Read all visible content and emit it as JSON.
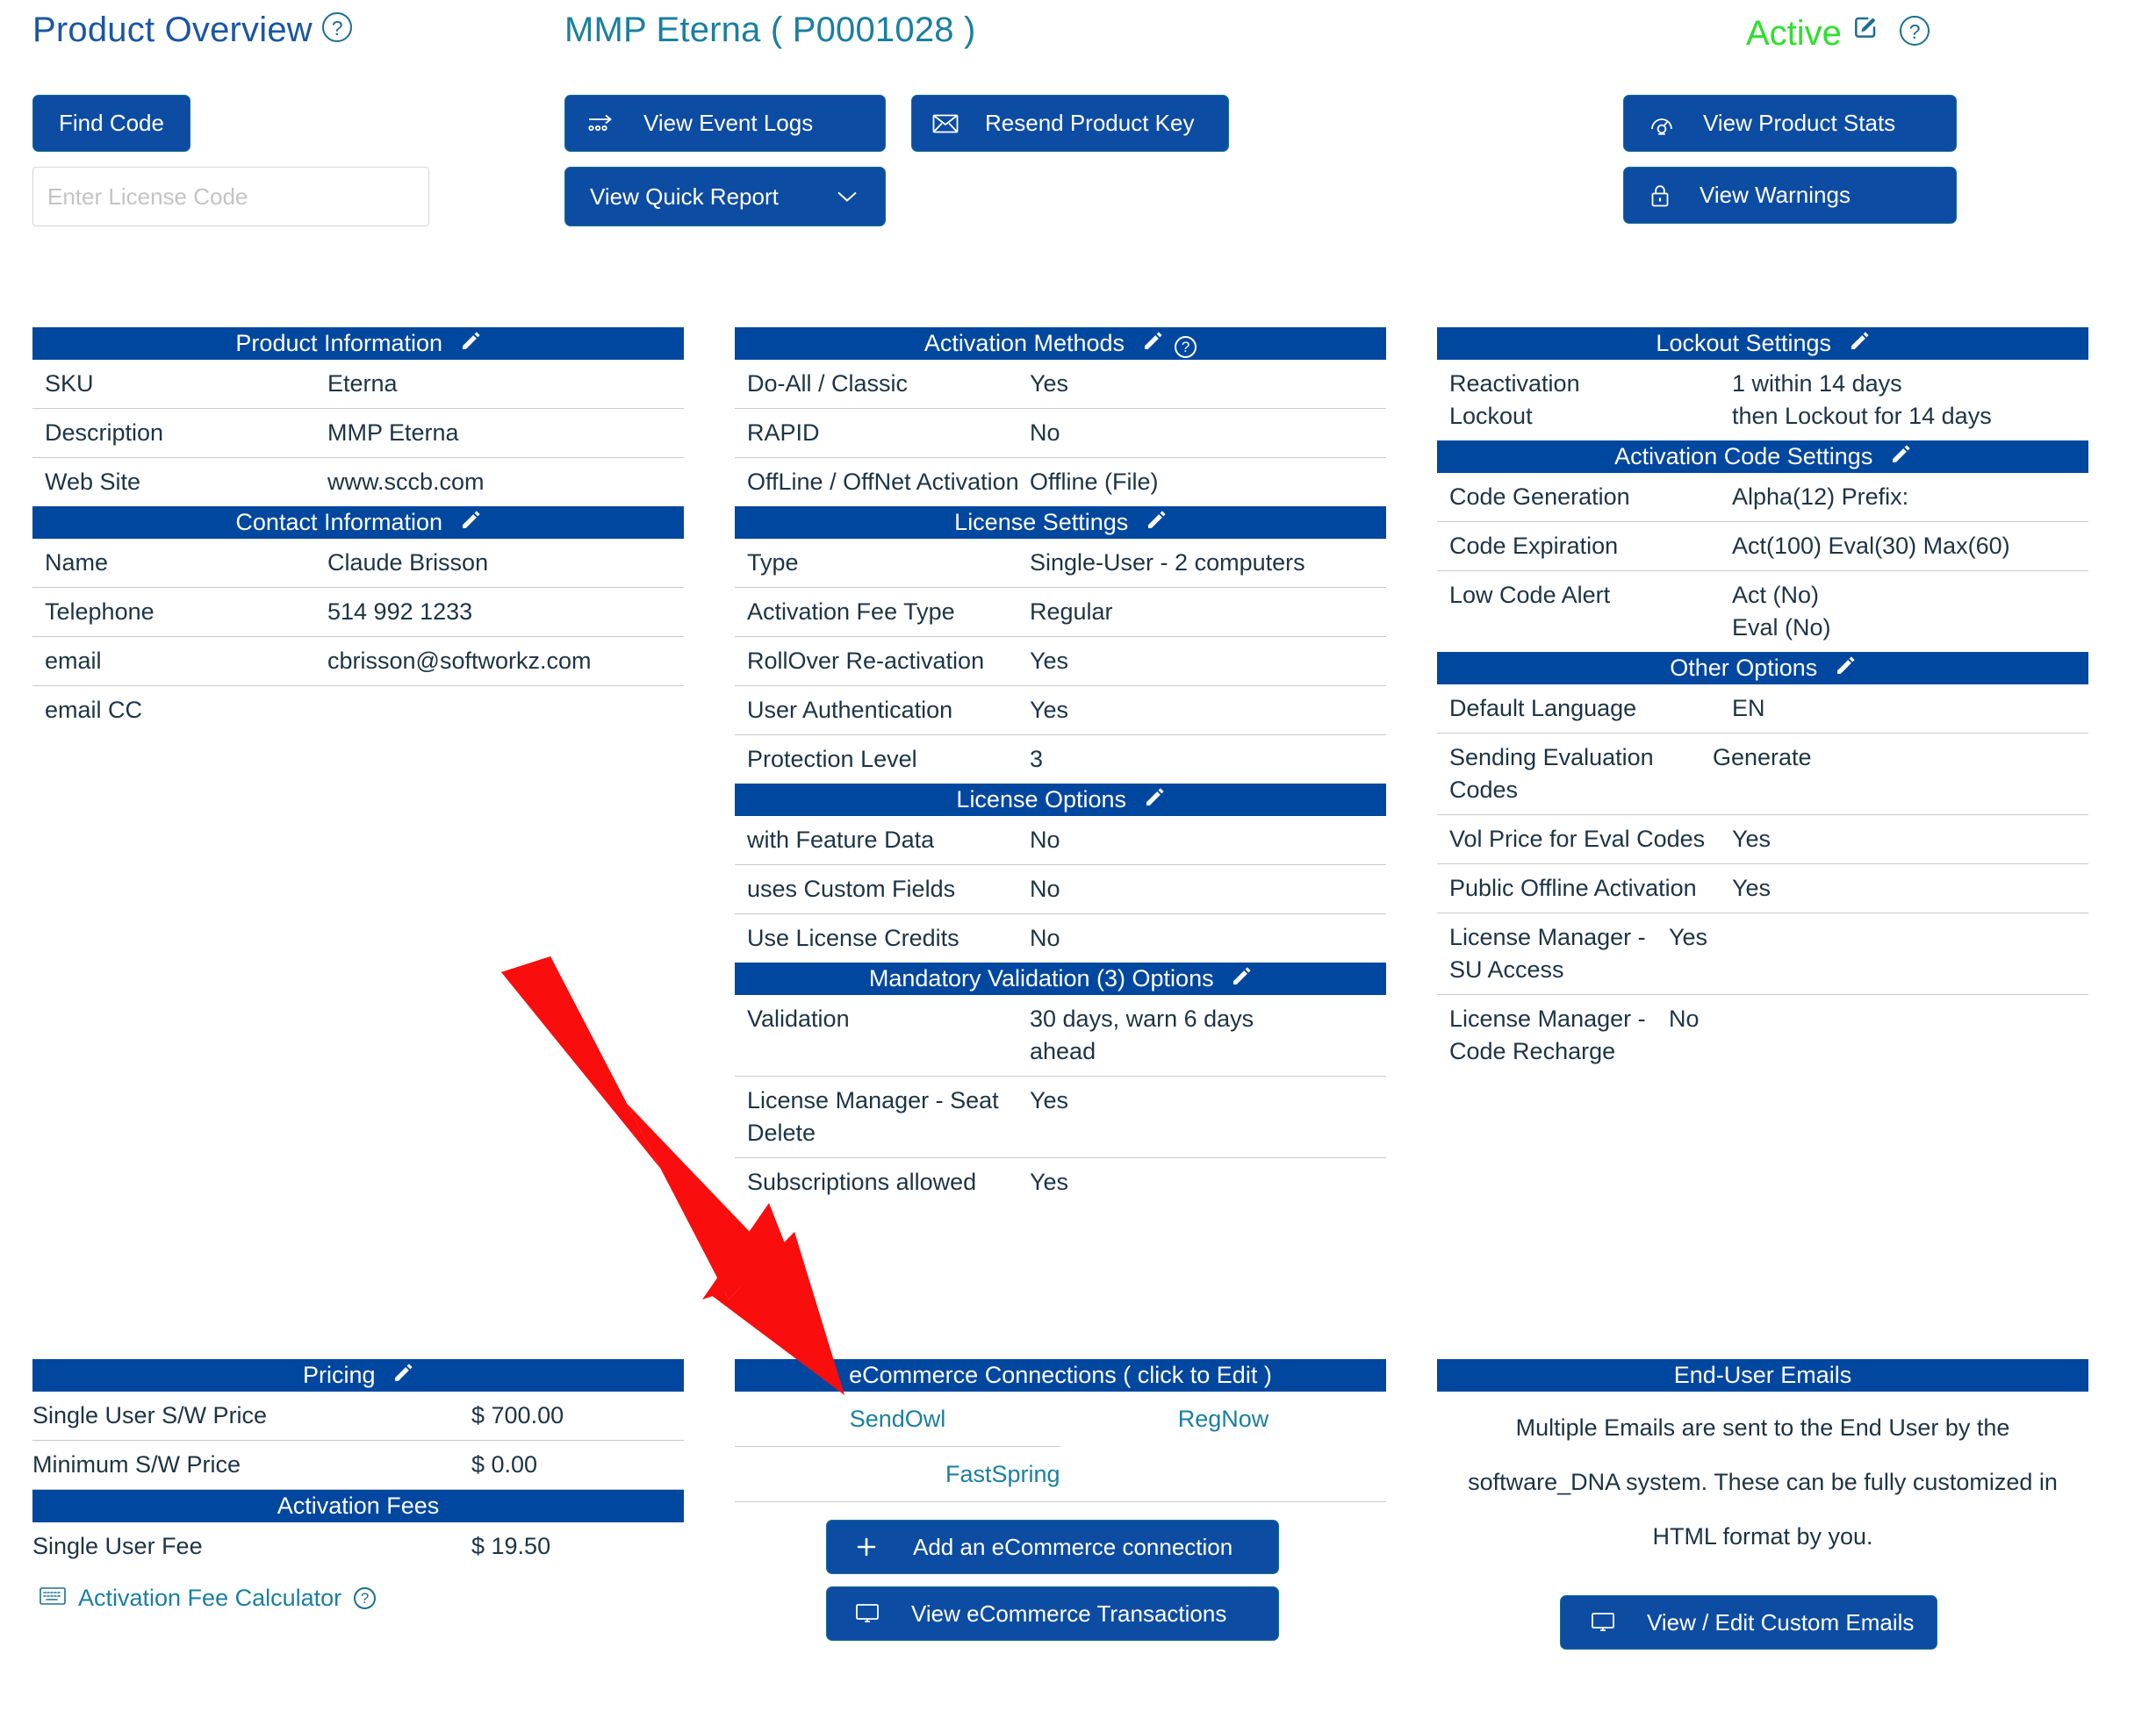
{
  "header": {
    "page_title": "Product Overview",
    "help_icon": "question-circle-icon",
    "product_title": "MMP Eterna ( P0001028 )",
    "status": "Active",
    "status_color": "#2de02d",
    "edit_icon": "edit-square-icon",
    "find_code_button": "Find Code",
    "license_code_placeholder": "Enter License Code",
    "license_code_value": "",
    "view_event_logs_button": "View Event Logs",
    "view_event_logs_icon": "arrow-flow-icon",
    "resend_product_key_button": "Resend Product Key",
    "resend_product_key_icon": "envelope-icon",
    "view_quick_report_button": "View Quick Report",
    "view_quick_report_caret": "chevron-down-icon",
    "view_product_stats_button": "View Product Stats",
    "view_product_stats_icon": "gauge-icon",
    "view_warnings_button": "View Warnings",
    "view_warnings_icon": "lock-icon"
  },
  "colors": {
    "section_header_bg": "#0047a0",
    "button_bg": "#0d4ca3",
    "link_teal": "#1a7fa0",
    "title_blue": "#1b56a4",
    "active_green": "#2de02d",
    "arrow_red": "#fa0d0d",
    "divider": "#c9c9c9"
  },
  "left_column": {
    "product_information": {
      "title": "Product Information",
      "edit_icon": "pencil-icon",
      "rows": [
        {
          "label": "SKU",
          "value": "Eterna"
        },
        {
          "label": "Description",
          "value": "MMP Eterna"
        },
        {
          "label": "Web Site",
          "value": "www.sccb.com"
        }
      ]
    },
    "contact_information": {
      "title": "Contact Information",
      "edit_icon": "pencil-icon",
      "rows": [
        {
          "label": "Name",
          "value": "Claude Brisson"
        },
        {
          "label": "Telephone",
          "value": "514 992 1233"
        },
        {
          "label": "email",
          "value": "cbrisson@softworkz.com"
        },
        {
          "label": "email CC",
          "value": ""
        }
      ]
    },
    "pricing": {
      "title": "Pricing",
      "edit_icon": "pencil-icon",
      "rows": [
        {
          "label": "Single User S/W Price",
          "value": "$ 700.00"
        },
        {
          "label": "Minimum S/W Price",
          "value": "$ 0.00"
        }
      ]
    },
    "activation_fees": {
      "title": "Activation Fees",
      "rows": [
        {
          "label": "Single User Fee",
          "value": "$ 19.50"
        }
      ],
      "calculator_link": "Activation Fee Calculator",
      "calculator_icon": "keyboard-icon",
      "calculator_help_icon": "question-circle-icon"
    }
  },
  "middle_column": {
    "activation_methods": {
      "title": "Activation Methods",
      "edit_icon": "pencil-icon",
      "help_icon": "question-circle-icon",
      "rows": [
        {
          "label": "Do-All / Classic",
          "value": "Yes"
        },
        {
          "label": "RAPID",
          "value": "No"
        },
        {
          "label": "OffLine / OffNet Activation",
          "value": "Offline (File)"
        }
      ]
    },
    "license_settings": {
      "title": "License Settings",
      "edit_icon": "pencil-icon",
      "rows": [
        {
          "label": "Type",
          "value": "Single-User - 2 computers"
        },
        {
          "label": "Activation Fee Type",
          "value": "Regular"
        },
        {
          "label": "RollOver Re-activation",
          "value": "Yes"
        },
        {
          "label": "User Authentication",
          "value": "Yes"
        },
        {
          "label": "Protection Level",
          "value": "3"
        }
      ]
    },
    "license_options": {
      "title": "License Options",
      "edit_icon": "pencil-icon",
      "rows": [
        {
          "label": "with Feature Data",
          "value": "No"
        },
        {
          "label": "uses Custom Fields",
          "value": "No"
        },
        {
          "label": "Use License Credits",
          "value": "No"
        }
      ]
    },
    "mandatory_validation": {
      "title": "Mandatory Validation (3) Options",
      "edit_icon": "pencil-icon",
      "rows": [
        {
          "label": "Validation",
          "value": "30 days, warn 6 days ahead"
        },
        {
          "label": "License Manager - Seat Delete",
          "value": "Yes"
        },
        {
          "label": "Subscriptions allowed",
          "value": "Yes"
        }
      ]
    },
    "ecommerce": {
      "title": "eCommerce Connections ( click to Edit )",
      "connections": [
        "SendOwl",
        "RegNow",
        "FastSpring"
      ],
      "add_button": "Add an eCommerce connection",
      "add_icon": "plus-icon",
      "view_button": "View eCommerce Transactions",
      "view_icon": "monitor-icon"
    }
  },
  "right_column": {
    "lockout_settings": {
      "title": "Lockout Settings",
      "edit_icon": "pencil-icon",
      "rows": [
        {
          "label": "Reactivation",
          "value": "1 within 14 days"
        },
        {
          "label": "Lockout",
          "value": "then Lockout for 14 days"
        }
      ]
    },
    "activation_code_settings": {
      "title": "Activation Code Settings",
      "edit_icon": "pencil-icon",
      "rows": [
        {
          "label": "Code Generation",
          "value": "Alpha(12)   Prefix:"
        },
        {
          "label": "Code Expiration",
          "value": "Act(100)   Eval(30)   Max(60)"
        },
        {
          "label": "Low Code Alert",
          "value": "Act   (No)",
          "value2": "Eval (No)"
        }
      ]
    },
    "other_options": {
      "title": "Other Options",
      "edit_icon": "pencil-icon",
      "rows": [
        {
          "label": "Default Language",
          "value": "EN"
        },
        {
          "label": "Sending Evaluation Codes",
          "value": "Generate"
        },
        {
          "label": "Vol Price for Eval Codes",
          "value": "Yes"
        },
        {
          "label": "Public Offline Activation",
          "value": "Yes"
        },
        {
          "label": "License Manager - SU Access",
          "value": "Yes"
        },
        {
          "label": "License Manager - Code Recharge",
          "value": "No"
        }
      ]
    },
    "end_user_emails": {
      "title": "End-User Emails",
      "note": "Multiple Emails are sent to the End User by the software_DNA system. These can be fully customized in HTML format by you.",
      "button": "View / Edit Custom Emails",
      "button_icon": "monitor-icon"
    }
  },
  "annotation": {
    "arrow_icon": "red-arrow-pointing-down-right",
    "arrow_color": "#fa0d0d"
  }
}
